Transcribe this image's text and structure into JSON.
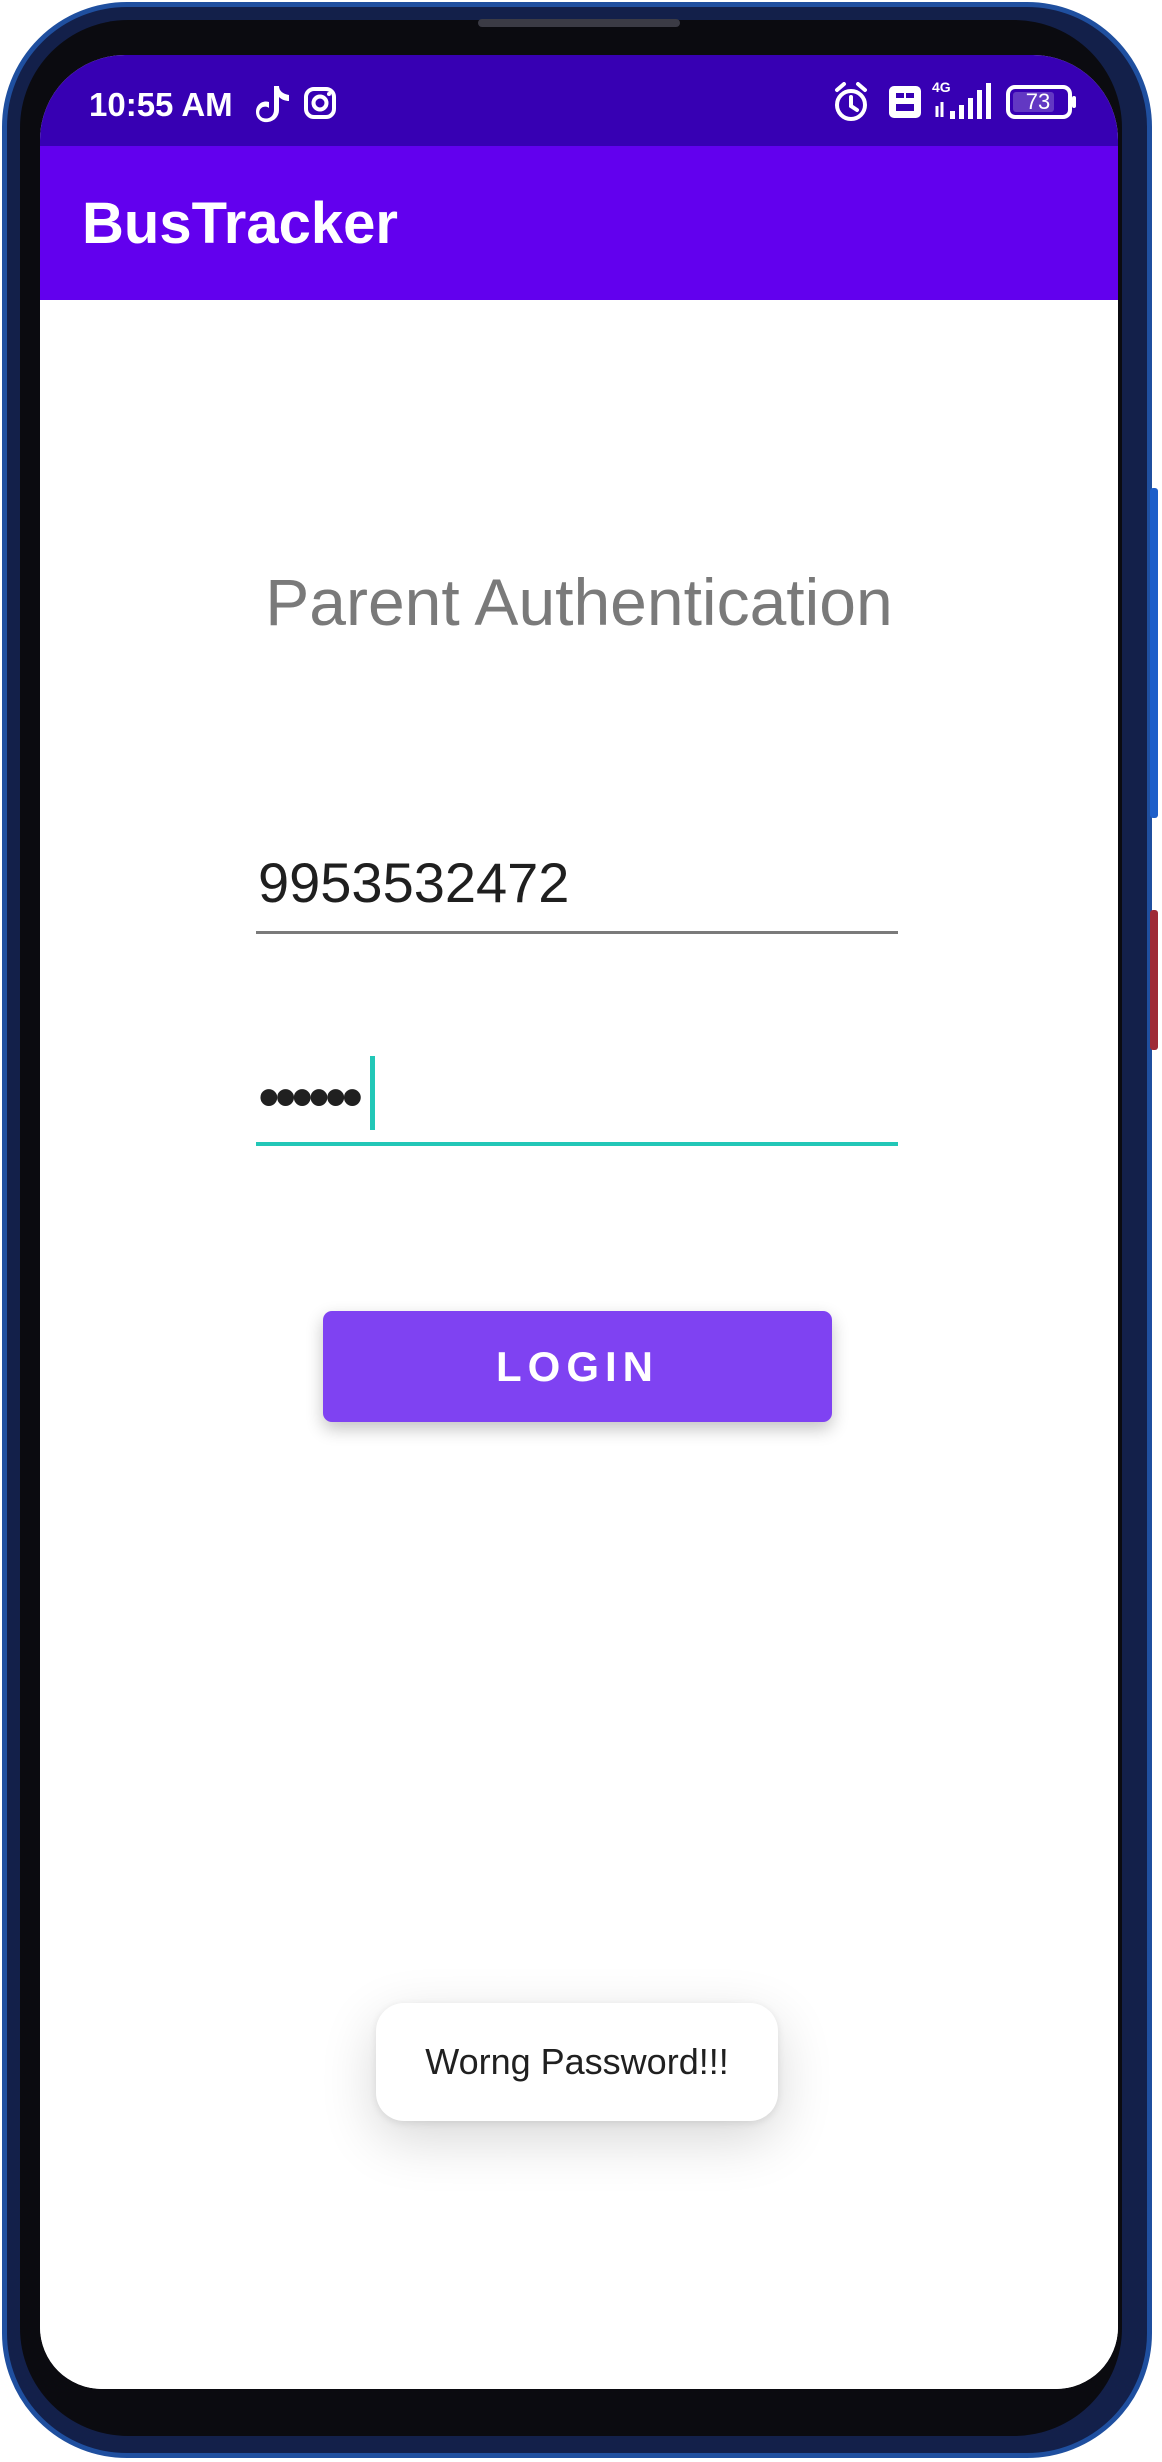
{
  "status_bar": {
    "time": "10:55 AM",
    "battery_level": "73",
    "network_label": "4G",
    "icons": [
      "tiktok-icon",
      "instagram-icon",
      "alarm-icon",
      "volte-icon",
      "signal-icon",
      "battery-icon"
    ]
  },
  "app_bar": {
    "title": "BusTracker"
  },
  "screen": {
    "title": "Parent Authentication",
    "phone_field": {
      "value": "9953532472"
    },
    "password_field": {
      "masked_value": "••••••",
      "focused": true
    },
    "login_button": {
      "label": "LOGIN"
    },
    "toast": {
      "message": "Worng Password!!!"
    }
  },
  "colors": {
    "status_bar": "#3700b3",
    "app_bar": "#6200ee",
    "button": "#7f42f2",
    "focus": "#22c7b7",
    "title_text": "#7a7a7a"
  }
}
